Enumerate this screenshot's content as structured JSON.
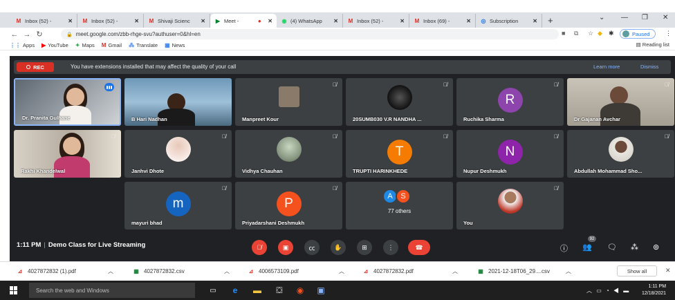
{
  "browser": {
    "tabs": [
      {
        "title": "Inbox (52) - ",
        "icon": "gmail-icon",
        "color": "#d93025",
        "active": false
      },
      {
        "title": "Inbox (52) - ",
        "icon": "gmail-icon",
        "color": "#d93025",
        "active": false
      },
      {
        "title": "Shivaji Scienc",
        "icon": "gmail-icon",
        "color": "#d93025",
        "active": false
      },
      {
        "title": "Meet - ",
        "icon": "meet-icon",
        "color": "#00832d",
        "active": true
      },
      {
        "title": "(4) WhatsApp",
        "icon": "whatsapp-icon",
        "color": "#25d366",
        "active": false
      },
      {
        "title": "Inbox (52) - ",
        "icon": "gmail-icon",
        "color": "#d93025",
        "active": false
      },
      {
        "title": "Inbox (69) - ",
        "icon": "gmail-icon",
        "color": "#d93025",
        "active": false
      },
      {
        "title": "Subscription",
        "icon": "subscription-icon",
        "color": "#1a73e8",
        "active": false
      }
    ],
    "url": "meet.google.com/zbb-rhge-svu?authuser=0&hl=en",
    "profile_status": "Paused",
    "bookmarks": [
      {
        "label": "Apps",
        "icon": "apps-icon",
        "color": "#1a73e8"
      },
      {
        "label": "YouTube",
        "icon": "youtube-icon",
        "color": "#ff0000"
      },
      {
        "label": "Maps",
        "icon": "maps-icon",
        "color": "#34a853"
      },
      {
        "label": "Gmail",
        "icon": "gmail-icon",
        "color": "#d93025"
      },
      {
        "label": "Translate",
        "icon": "translate-icon",
        "color": "#4285f4"
      },
      {
        "label": "News",
        "icon": "news-icon",
        "color": "#4285f4"
      }
    ],
    "reading_list": "Reading list"
  },
  "meet": {
    "banner": {
      "rec_label": "REC",
      "message": "You have extensions installed that may affect the quality of your call",
      "learn_more": "Learn more",
      "dismiss": "Dismiss"
    },
    "tiles": [
      {
        "name": "Dr. Pranita Gulhane",
        "type": "video",
        "speaking": true
      },
      {
        "name": "B Hari Nadhan",
        "type": "video"
      },
      {
        "name": "Manpreet Kour",
        "type": "video-small"
      },
      {
        "name": "20SUMB030 V.R NANDHA ...",
        "type": "photo-dark"
      },
      {
        "name": "Ruchika Sharma",
        "type": "letter",
        "letter": "R",
        "color": "#8e44ad"
      },
      {
        "name": "Dr Gajanan Avchar",
        "type": "video"
      },
      {
        "name": "Rakhi Khandelwal",
        "type": "video"
      },
      {
        "name": "Janhvi Dhote",
        "type": "photo"
      },
      {
        "name": "Vidhya Chauhan",
        "type": "photo"
      },
      {
        "name": "TRUPTI HARINKHEDE",
        "type": "letter",
        "letter": "T",
        "color": "#f57c00"
      },
      {
        "name": "Nupur Deshmukh",
        "type": "letter",
        "letter": "N",
        "color": "#8e24aa"
      },
      {
        "name": "Abdullah Mohammad Sho...",
        "type": "photo"
      },
      {
        "name": "mayuri bhad",
        "type": "letter",
        "letter": "m",
        "color": "#1565c0"
      },
      {
        "name": "Priyadarshani Deshmukh",
        "type": "letter",
        "letter": "P",
        "color": "#f4511e"
      },
      {
        "name": "77 others",
        "type": "others",
        "letters": [
          "A",
          "S"
        ]
      },
      {
        "name": "You",
        "type": "photo"
      }
    ],
    "time": "1:11 PM",
    "meeting_name": "Demo Class for Live Streaming",
    "participant_count": "92"
  },
  "downloads": {
    "items": [
      {
        "name": "4027872832 (1).pdf",
        "type": "pdf"
      },
      {
        "name": "4027872832.csv",
        "type": "csv"
      },
      {
        "name": "4006573109.pdf",
        "type": "pdf"
      },
      {
        "name": "4027872832.pdf",
        "type": "pdf"
      },
      {
        "name": "2021-12-18T06_29....csv",
        "type": "csv"
      }
    ],
    "show_all": "Show all"
  },
  "taskbar": {
    "search_placeholder": "Search the web and Windows",
    "clock_time": "1:11 PM",
    "clock_date": "12/18/2021"
  },
  "colors": {
    "meet_bg": "#202124",
    "tile_bg": "#3c4043",
    "accent": "#1a73e8",
    "danger": "#ea4335"
  }
}
